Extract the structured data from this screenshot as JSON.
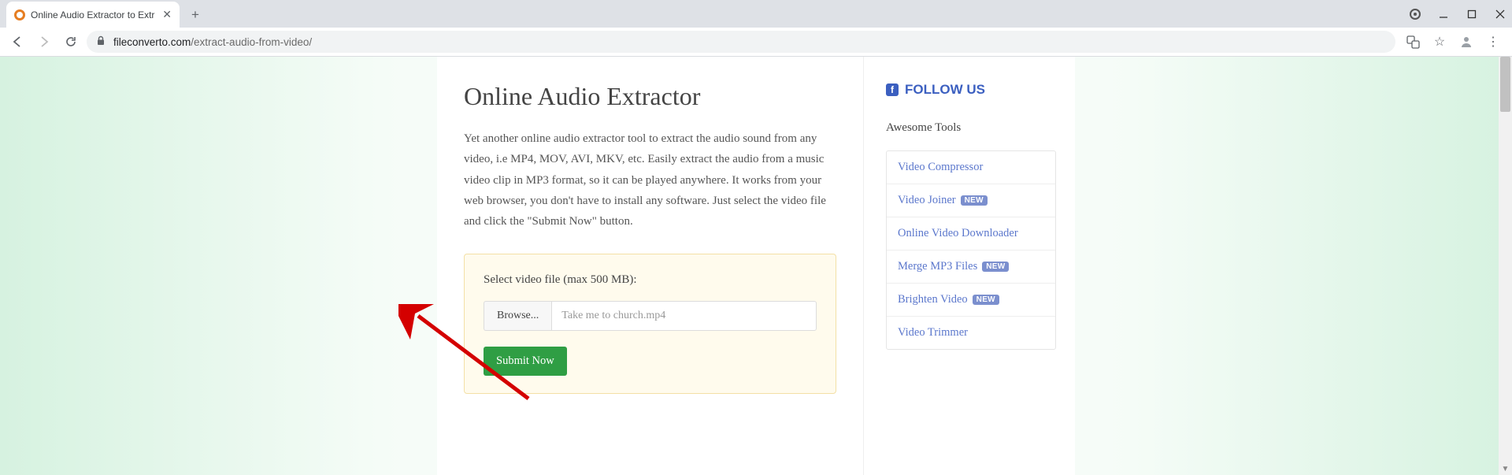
{
  "browser": {
    "tab_title": "Online Audio Extractor to Extr",
    "url_host": "fileconverto.com",
    "url_path": "/extract-audio-from-video/"
  },
  "main": {
    "title": "Online Audio Extractor",
    "description": "Yet another online audio extractor tool to extract the audio sound from any video, i.e MP4, MOV, AVI, MKV, etc. Easily extract the audio from a music video clip in MP3 format, so it can be played anywhere. It works from your web browser, you don't have to install any software. Just select the video file and click the \"Submit Now\" button.",
    "upload_label": "Select video file (max 500 MB):",
    "browse_label": "Browse...",
    "selected_file": "Take me to church.mp4",
    "submit_label": "Submit Now"
  },
  "sidebar": {
    "follow_label": "FOLLOW US",
    "tools_heading": "Awesome Tools",
    "new_badge": "NEW",
    "tools": [
      {
        "label": "Video Compressor",
        "new": false
      },
      {
        "label": "Video Joiner",
        "new": true
      },
      {
        "label": "Online Video Downloader",
        "new": false
      },
      {
        "label": "Merge MP3 Files",
        "new": true
      },
      {
        "label": "Brighten Video",
        "new": true
      },
      {
        "label": "Video Trimmer",
        "new": false
      }
    ]
  }
}
